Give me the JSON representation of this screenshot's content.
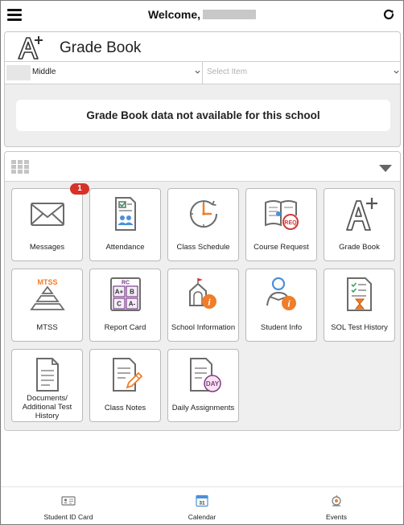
{
  "header": {
    "welcome": "Welcome,",
    "menu_icon": "hamburger-menu-icon",
    "refresh_icon": "refresh-icon"
  },
  "gradebook": {
    "title": "Grade Book",
    "icon": "grade-a-plus-icon",
    "school_select_value": "Middle",
    "item_select_placeholder": "Select Item",
    "notice": "Grade Book data not available for this school"
  },
  "apps": {
    "layout_icon": "grid-view-icon",
    "collapse_icon": "collapse-triangle-icon",
    "tiles": [
      {
        "label": "Messages",
        "icon": "envelope-icon",
        "badge": "1"
      },
      {
        "label": "Attendance",
        "icon": "attendance-clipboard-icon"
      },
      {
        "label": "Class Schedule",
        "icon": "clock-icon"
      },
      {
        "label": "Course Request",
        "icon": "course-request-book-icon"
      },
      {
        "label": "Grade Book",
        "icon": "grade-a-plus-icon"
      },
      {
        "label": "MTSS",
        "icon": "mtss-pyramid-icon"
      },
      {
        "label": "Report Card",
        "icon": "report-card-icon"
      },
      {
        "label": "School Information",
        "icon": "school-info-icon"
      },
      {
        "label": "Student Info",
        "icon": "student-info-icon"
      },
      {
        "label": "SOL Test History",
        "icon": "test-history-icon"
      },
      {
        "label": "Documents/ Additional Test History",
        "icon": "document-icon"
      },
      {
        "label": "Class Notes",
        "icon": "notes-pencil-icon"
      },
      {
        "label": "Daily Assignments",
        "icon": "daily-assignments-icon"
      }
    ]
  },
  "bottom_nav": [
    {
      "label": "Student ID Card",
      "icon": "id-card-icon"
    },
    {
      "label": "Calendar",
      "icon": "calendar-icon",
      "icon_text": "31"
    },
    {
      "label": "Events",
      "icon": "events-icon"
    }
  ],
  "colors": {
    "accent_orange": "#f07d2a",
    "accent_blue": "#4a90d9",
    "icon_gray": "#6b6b6b",
    "badge_red": "#d63228",
    "mtss_purple": "#7b3f8a"
  }
}
